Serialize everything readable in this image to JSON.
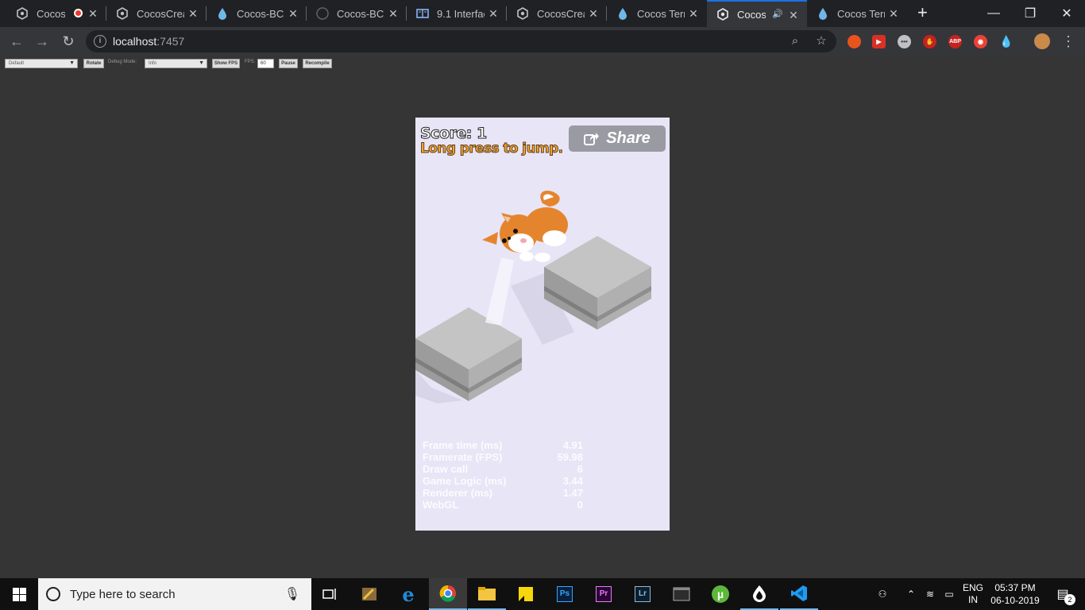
{
  "browser": {
    "tabs": [
      {
        "title": "CocosC",
        "icon": "cocos-icon",
        "recording": true
      },
      {
        "title": "CocosCreat",
        "icon": "cocos-icon"
      },
      {
        "title": "Cocos-BCX",
        "icon": "bcx-drop-icon"
      },
      {
        "title": "Cocos-BCX/",
        "icon": "github-icon"
      },
      {
        "title": "9.1 Interfac",
        "icon": "book-icon"
      },
      {
        "title": "CocosCreat",
        "icon": "cocos-icon"
      },
      {
        "title": "Cocos Term",
        "icon": "bcx-drop-icon"
      },
      {
        "title": "CocosC",
        "icon": "cocos-icon",
        "active": true,
        "audio": true
      },
      {
        "title": "Cocos Term",
        "icon": "bcx-drop-icon"
      }
    ],
    "url_host": "localhost",
    "url_port": ":7457"
  },
  "preview_toolbar": {
    "device": "Default",
    "rotate": "Rotate",
    "debug_label": "Debug Mode:",
    "debug_value": "Info",
    "show_fps": "Show FPS",
    "fps_label": "FPS:",
    "fps_value": "60",
    "pause": "Pause",
    "recompile": "Recompile"
  },
  "game": {
    "score": "Score: 1",
    "hint": "Long press to jump.",
    "share": "Share",
    "stats": [
      {
        "label": "Frame time (ms)",
        "value": "4.91"
      },
      {
        "label": "Framerate (FPS)",
        "value": "59.98"
      },
      {
        "label": "Draw call",
        "value": "6"
      },
      {
        "label": "Game Logic (ms)",
        "value": "3.44"
      },
      {
        "label": "Renderer (ms)",
        "value": "1.47"
      },
      {
        "label": "WebGL",
        "value": "0"
      }
    ]
  },
  "taskbar": {
    "search_placeholder": "Type here to search",
    "lang": "ENG",
    "region": "IN",
    "time": "05:37 PM",
    "date": "06-10-2019",
    "notifications": "2"
  },
  "colors": {
    "tabstrip": "#202124",
    "toolbar": "#35363a",
    "page": "#353535",
    "canvas": "#e8e5f6",
    "accent": "#1a73e8"
  }
}
